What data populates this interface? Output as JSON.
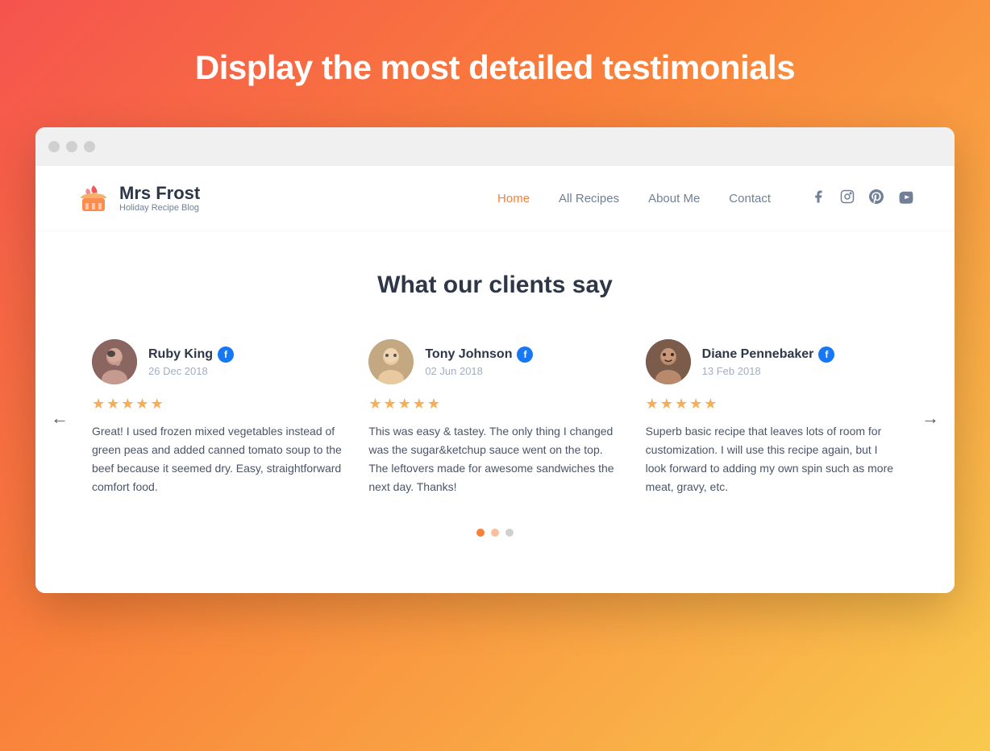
{
  "page": {
    "hero_title": "Display the most detailed testimonials"
  },
  "brand": {
    "name": "Mrs Frost",
    "subtitle": "Holiday Recipe Blog"
  },
  "nav": {
    "links": [
      {
        "label": "Home",
        "active": true
      },
      {
        "label": "All Recipes",
        "active": false
      },
      {
        "label": "About Me",
        "active": false
      },
      {
        "label": "Contact",
        "active": false
      }
    ]
  },
  "social": {
    "icons": [
      "f",
      "instagram",
      "pinterest",
      "youtube"
    ]
  },
  "section": {
    "title": "What our clients say"
  },
  "testimonials": [
    {
      "name": "Ruby King",
      "date": "26 Dec 2018",
      "stars": 5,
      "text": "Great! I used frozen mixed vegetables instead of green peas and added canned tomato soup to the beef because it seemed dry. Easy, straightforward comfort food.",
      "platform": "facebook"
    },
    {
      "name": "Tony Johnson",
      "date": "02 Jun 2018",
      "stars": 5,
      "text": "This was easy & tastey. The only thing I changed was the sugar&ketchup sauce went on the top. The leftovers made for awesome sandwiches the next day. Thanks!",
      "platform": "facebook"
    },
    {
      "name": "Diane Pennebaker",
      "date": "13 Feb 2018",
      "stars": 5,
      "text": "Superb basic recipe that leaves lots of room for customization. I will use this recipe again, but I look forward to adding my own spin such as more meat, gravy, etc.",
      "platform": "facebook"
    }
  ],
  "pagination": {
    "dots": 3,
    "active": 0
  },
  "arrows": {
    "left": "←",
    "right": "→"
  }
}
